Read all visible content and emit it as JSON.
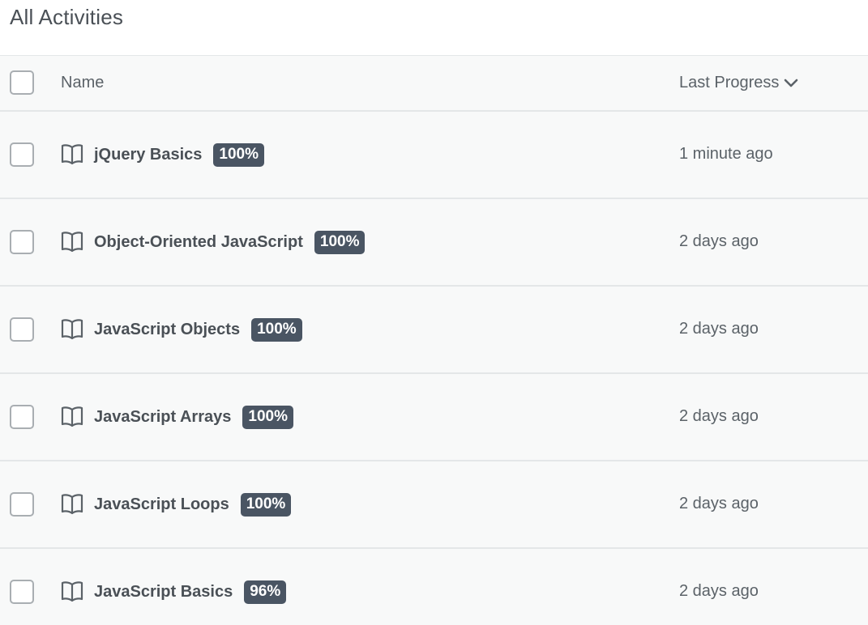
{
  "page": {
    "title": "All Activities"
  },
  "table": {
    "headers": {
      "name": "Name",
      "last_progress": "Last Progress"
    },
    "rows": [
      {
        "name": "jQuery Basics",
        "progress": "100%",
        "last_progress": "1 minute ago"
      },
      {
        "name": "Object-Oriented JavaScript",
        "progress": "100%",
        "last_progress": "2 days ago"
      },
      {
        "name": "JavaScript Objects",
        "progress": "100%",
        "last_progress": "2 days ago"
      },
      {
        "name": "JavaScript Arrays",
        "progress": "100%",
        "last_progress": "2 days ago"
      },
      {
        "name": "JavaScript Loops",
        "progress": "100%",
        "last_progress": "2 days ago"
      },
      {
        "name": "JavaScript Basics",
        "progress": "96%",
        "last_progress": "2 days ago"
      }
    ]
  },
  "icons": {
    "activity": "book-open-icon",
    "sort": "chevron-down-icon"
  },
  "colors": {
    "badge_bg": "#4a5563",
    "text": "#4a5056",
    "row_bg": "#f8f9f9",
    "divider": "#e4e7e8"
  }
}
